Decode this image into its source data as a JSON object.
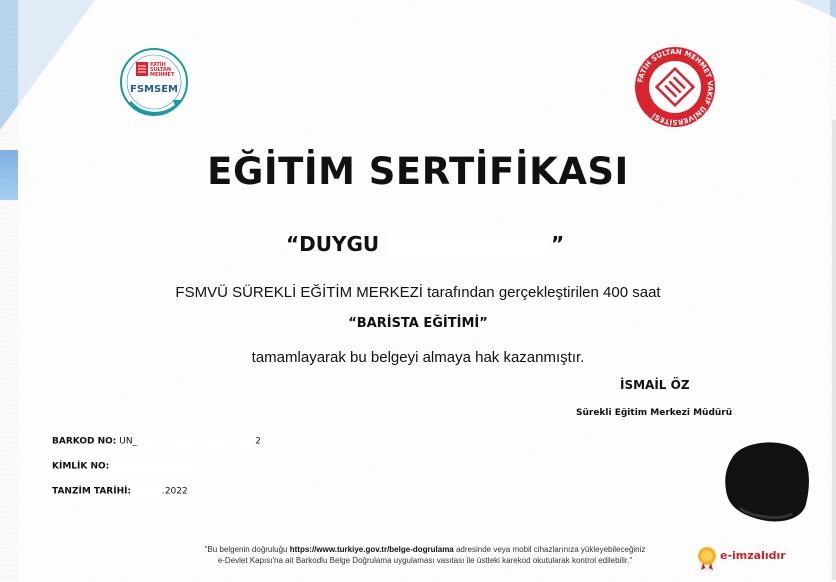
{
  "logos": {
    "left": {
      "ring_text": "FATİH SULTAN MEHMET VAKIF ÜNİVERSİTESİ",
      "inner_text_1": "FATİH",
      "inner_text_2": "SULTAN",
      "inner_text_3": "MEHMET",
      "name": "FSMSEM",
      "colors": {
        "ring": "#1a9aa0",
        "mark": "#d9232d"
      }
    },
    "right": {
      "ring_text": "FATİH SULTAN MEHMET VAKIF ÜNİVERSİTESİ",
      "colors": {
        "ring": "#d9232d",
        "center": "#ffffff"
      }
    }
  },
  "certificate": {
    "title": "EĞİTİM SERTİFİKASI",
    "recipient_open": "“DUYGU",
    "recipient_close": "”",
    "line1": "FSMVÜ SÜREKLİ EĞİTİM MERKEZİ tarafından gerçekleştirilen 400 saat",
    "course": "“BARİSTA EĞİTİMİ”",
    "line2": "tamamlayarak bu belgeyi almaya hak kazanmıştır."
  },
  "signatory": {
    "name": "İSMAİL ÖZ",
    "title": "Sürekli Eğitim Merkezi Müdürü"
  },
  "fields": {
    "barcode_label": "BARKOD NO:",
    "barcode_value": "UN_",
    "barcode_tail": "2",
    "id_label": "KİMLİK NO:",
    "id_value": "",
    "date_label": "TANZİM TARİHİ:",
    "date_value": ".2022"
  },
  "footer": {
    "part1": "\"Bu belgenin doğruluğu ",
    "url": "https://www.turkiye.gov.tr/belge-dogrulama",
    "part2": " adresinde veya mobil cihazlarınıza yükleyebileceğiniz",
    "line2": "e-Devlet Kapısı'na ait Barkodlu Belge Doğrulama uygulaması vasıtası ile üstteki karekod okutularak kontrol edilebilir.\""
  },
  "esign": {
    "label": "e-imzalıdır",
    "icon": "seal-icon",
    "color": "#c8242b"
  }
}
